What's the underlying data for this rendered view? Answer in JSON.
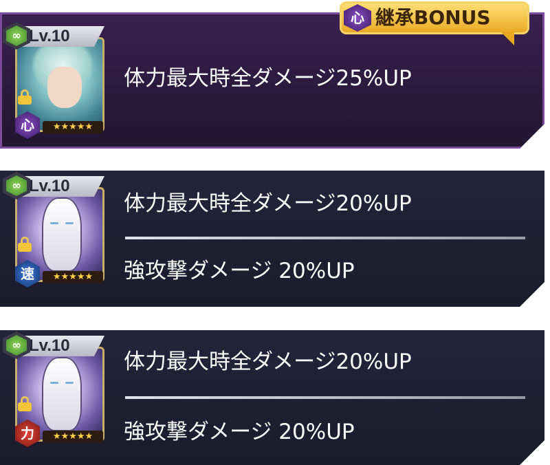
{
  "cards": [
    {
      "level": "Lv.10",
      "attribute": "心",
      "stars": "★★★★★",
      "effects": [
        "体力最大時全ダメージ25%UP"
      ],
      "bonus_icon": "心",
      "bonus_label": "継承BONUS"
    },
    {
      "level": "Lv.10",
      "attribute": "速",
      "stars": "★★★★★",
      "effects": [
        "体力最大時全ダメージ20%UP",
        "強攻撃ダメージ 20%UP"
      ]
    },
    {
      "level": "Lv.10",
      "attribute": "力",
      "stars": "★★★★★",
      "effects": [
        "体力最大時全ダメージ20%UP",
        "強攻撃ダメージ 20%UP"
      ]
    }
  ],
  "colors": {
    "card_heart_bg": "#2c1a3e",
    "card_dark_bg": "#1b1b2c",
    "bonus_gold": "#f0b630",
    "text": "#ffffff"
  },
  "icons": {
    "link": "link-icon",
    "lock": "lock-icon",
    "star": "star-icon"
  }
}
